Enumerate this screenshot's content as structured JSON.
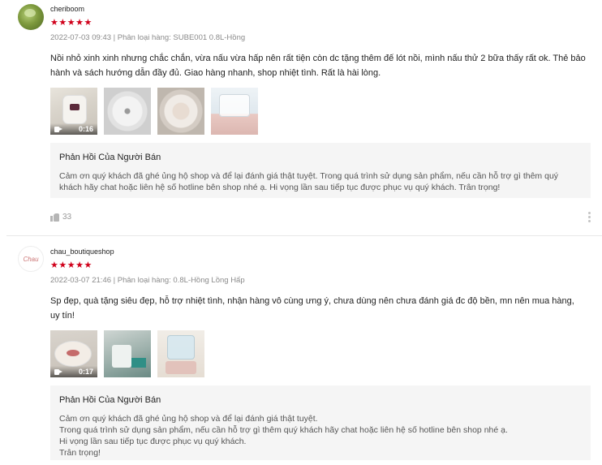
{
  "reviews": [
    {
      "username": "cheriboom",
      "stars": "★★★★★",
      "rating": 5,
      "meta": "2022-07-03 09:43 | Phân loại hàng: SUBE001 0.8L-Hồng",
      "comment": "Nồi nhỏ xinh xinh nhưng chắc chắn, vừa nấu vừa hấp nên rất tiện còn dc tặng thêm đế lót nồi, mình nấu thử 2 bữa thấy rất ok. Thẻ bảo hành và sách hướng dẫn đầy đủ. Giao hàng nhanh, shop nhiệt tình. Rất là hài lòng.",
      "media": {
        "video_duration": "0:16"
      },
      "seller_reply": {
        "title": "Phản Hồi Của Người Bán",
        "body": "Cảm ơn quý khách đã ghé ủng hộ shop và để lại đánh giá thật tuyệt. Trong quá trình sử dụng sản phẩm, nếu cần hỗ trợ gì thêm quý khách hãy chat hoặc liên hệ số hotline bên shop nhé ạ. Hi vọng lần sau tiếp tục được phục vụ quý khách. Trân trọng!"
      },
      "likes": "33"
    },
    {
      "username": "chau_boutiqueshop",
      "avatar_text": "Chau",
      "stars": "★★★★★",
      "rating": 5,
      "meta": "2022-03-07 21:46 | Phân loại hàng: 0.8L-Hồng Lồng Hấp",
      "comment": "Sp đẹp, quà tặng siêu đẹp, hỗ trợ nhiệt tình, nhận hàng vô cùng ưng ý, chưa dùng nên chưa đánh giá đc độ bền, mn nên mua hàng, uy tín!",
      "media": {
        "video_duration": "0:17"
      },
      "seller_reply": {
        "title": "Phản Hồi Của Người Bán",
        "line1": "Cảm ơn quý khách đã ghé ủng hộ shop và để lại đánh giá thật tuyệt.",
        "line2": "Trong quá trình sử dụng sản phẩm, nếu cần hỗ trợ gì thêm quý khách hãy chat hoặc liên hệ số hotline bên shop nhé ạ.",
        "line3": "Hi vọng lần sau tiếp tục được phục vụ quý khách.",
        "line4": "Trân trọng!"
      }
    }
  ],
  "colors": {
    "star": "#d0011b",
    "meta": "#8a8a8a",
    "reply_bg": "#f5f5f5"
  },
  "icons": {
    "like": "thumbs-up-icon",
    "more": "more-vertical-icon",
    "video": "video-camera-icon"
  }
}
